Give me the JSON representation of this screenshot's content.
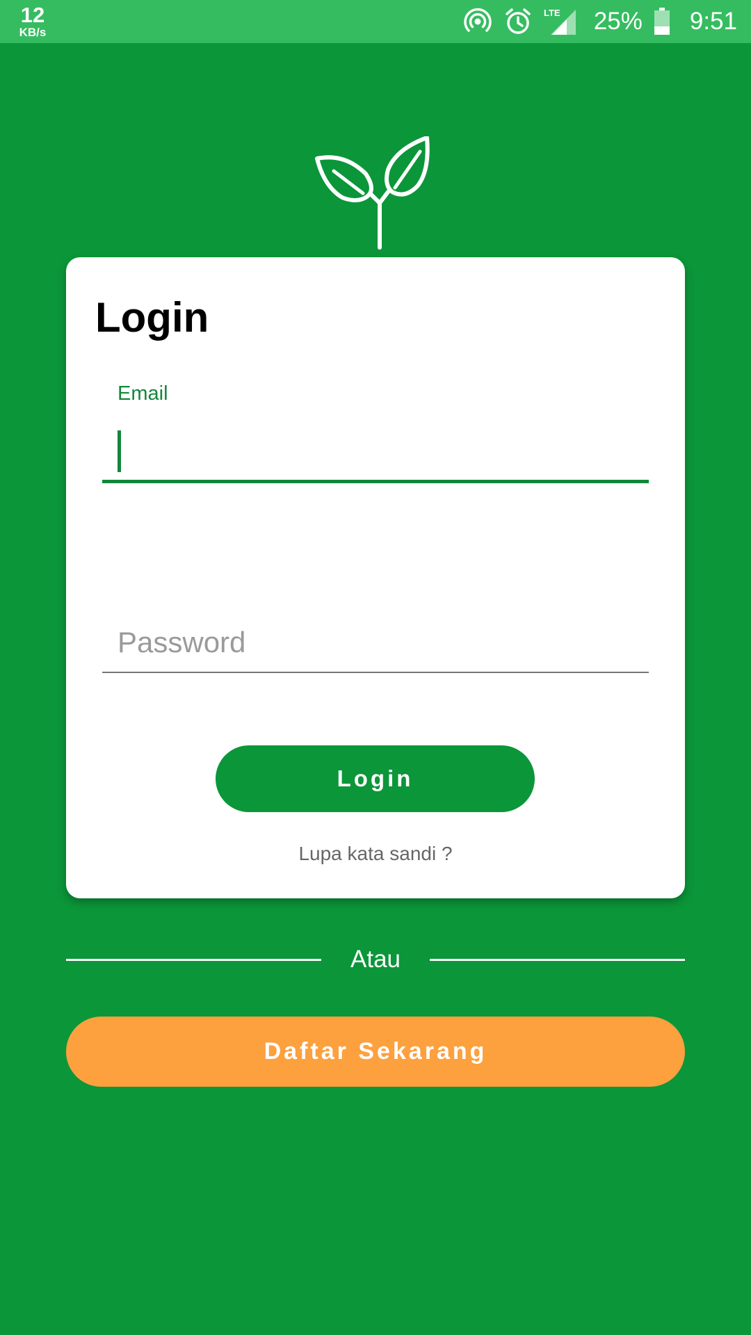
{
  "status_bar": {
    "net_speed_value": "12",
    "net_speed_unit": "KB/s",
    "network_type": "LTE",
    "battery_percent": "25%",
    "time": "9:51",
    "icons": [
      "hotspot-icon",
      "alarm-icon",
      "lte-signal-icon",
      "battery-icon"
    ]
  },
  "logo": {
    "icon": "plant-sprout-icon"
  },
  "login_card": {
    "title": "Login",
    "email_label": "Email",
    "email_value": "",
    "password_placeholder": "Password",
    "password_value": "",
    "login_button_label": "Login",
    "forgot_password_link": "Lupa kata sandi ?"
  },
  "divider_text": "Atau",
  "register_button_label": "Daftar Sekarang",
  "colors": {
    "background": "#0b9639",
    "status_bar": "#36bc60",
    "accent_green": "#12873b",
    "register_orange": "#fda03e",
    "card": "#ffffff"
  }
}
